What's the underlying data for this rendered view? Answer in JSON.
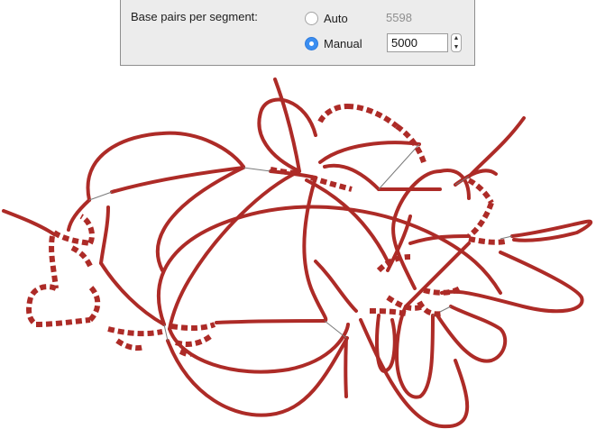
{
  "settings": {
    "title": "Base pairs per segment:",
    "options": [
      {
        "label": "Auto",
        "selected": false
      },
      {
        "label": "Manual",
        "selected": true
      }
    ],
    "auto_value": "5598",
    "manual_value": "5000",
    "stepper_up_icon": "chevron-up-icon",
    "stepper_down_icon": "chevron-down-icon"
  },
  "graph": {
    "edge_color": "#ad2b27",
    "link_color": "#7a7a7a",
    "radio_accent": "#3b8ef1"
  }
}
